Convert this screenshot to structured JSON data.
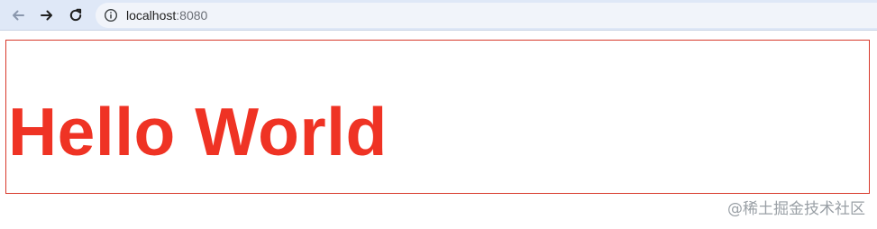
{
  "browser": {
    "nav": {
      "back_icon": "arrow-left-icon",
      "forward_icon": "arrow-right-icon",
      "reload_icon": "reload-icon"
    },
    "address_bar": {
      "info_icon": "info-circle-icon",
      "host": "localhost",
      "port": ":8080"
    }
  },
  "page": {
    "heading": "Hello World",
    "colors": {
      "heading": "#ef3324",
      "box_border": "#d83a2c"
    }
  },
  "watermark": {
    "text": "@稀土掘金技术社区"
  }
}
